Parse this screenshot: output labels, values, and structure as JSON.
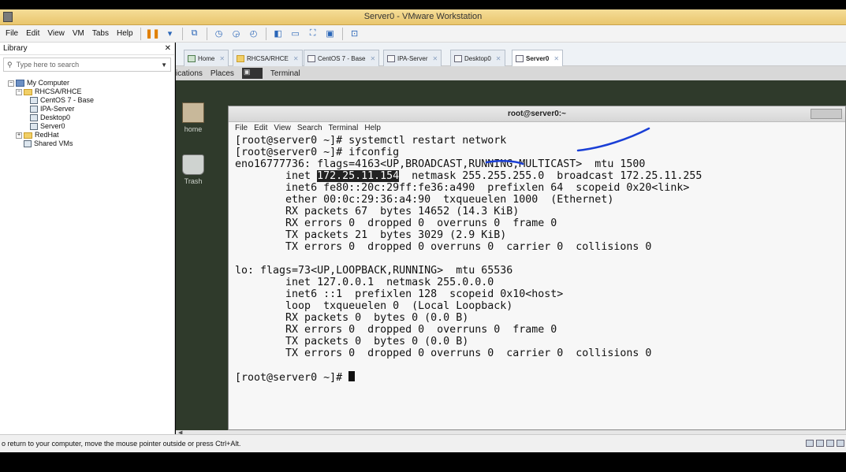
{
  "window": {
    "title": "Server0 - VMware Workstation"
  },
  "menubar": {
    "items": [
      "File",
      "Edit",
      "View",
      "VM",
      "Tabs",
      "Help"
    ]
  },
  "library": {
    "title": "Library",
    "search_placeholder": "Type here to search",
    "tree": {
      "root": "My Computer",
      "group": "RHCSA/RHCE",
      "vms": [
        "CentOS 7 - Base",
        "IPA-Server",
        "Desktop0",
        "Server0"
      ],
      "other_folder": "RedHat",
      "shared": "Shared VMs"
    }
  },
  "tabs": [
    {
      "label": "Home"
    },
    {
      "label": "RHCSA/RHCE"
    },
    {
      "label": "CentOS 7 - Base"
    },
    {
      "label": "IPA-Server"
    },
    {
      "label": "Desktop0"
    },
    {
      "label": "Server0",
      "active": true
    }
  ],
  "guest": {
    "panel": {
      "applications": "ications",
      "places": "Places",
      "terminal": "Terminal"
    },
    "desktop_icons": {
      "home": "home",
      "trash": "Trash"
    },
    "terminal": {
      "title": "root@server0:~",
      "menu": [
        "File",
        "Edit",
        "View",
        "Search",
        "Terminal",
        "Help"
      ],
      "prompt": "[root@server0 ~]# ",
      "cmd1": "systemctl restart network",
      "cmd2": "ifconfig",
      "iface1_header": "eno16777736: flags=4163<UP,BROADCAST,RUNNING,MULTICAST>  mtu 1500",
      "iface1_inet_pre": "        inet ",
      "iface1_inet_ip": "172.25.11.154",
      "iface1_inet_post": "  netmask 255.255.255.0  broadcast 172.25.11.255",
      "iface1_lines": [
        "        inet6 fe80::20c:29ff:fe36:a490  prefixlen 64  scopeid 0x20<link>",
        "        ether 00:0c:29:36:a4:90  txqueuelen 1000  (Ethernet)",
        "        RX packets 67  bytes 14652 (14.3 KiB)",
        "        RX errors 0  dropped 0  overruns 0  frame 0",
        "        TX packets 21  bytes 3029 (2.9 KiB)",
        "        TX errors 0  dropped 0 overruns 0  carrier 0  collisions 0"
      ],
      "iface2_lines": [
        "lo: flags=73<UP,LOOPBACK,RUNNING>  mtu 65536",
        "        inet 127.0.0.1  netmask 255.0.0.0",
        "        inet6 ::1  prefixlen 128  scopeid 0x10<host>",
        "        loop  txqueuelen 0  (Local Loopback)",
        "        RX packets 0  bytes 0 (0.0 B)",
        "        RX errors 0  dropped 0  overruns 0  frame 0",
        "        TX packets 0  bytes 0 (0.0 B)",
        "        TX errors 0  dropped 0 overruns 0  carrier 0  collisions 0"
      ]
    }
  },
  "statusbar": {
    "text": "o return to your computer, move the mouse pointer outside or press Ctrl+Alt."
  },
  "colors": {
    "titlebar": "#e9c66d",
    "annotation": "#1a3fd6",
    "desktop": "#2f3a2b"
  }
}
